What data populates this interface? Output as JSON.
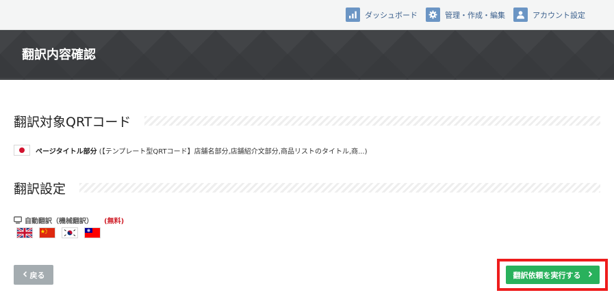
{
  "nav": {
    "items": [
      {
        "label": "ダッシュボード",
        "icon": "bar-chart-icon"
      },
      {
        "label": "管理・作成・編集",
        "icon": "gear-icon"
      },
      {
        "label": "アカウント設定",
        "icon": "user-icon"
      }
    ]
  },
  "banner": {
    "title": "翻訳内容確認"
  },
  "target_section": {
    "heading": "翻訳対象QRTコード",
    "flag_icon": "japan-flag-icon",
    "item_label": "ページタイトル部分",
    "item_detail": " (【テンプレート型QRTコード】店舗名部分,店舗紹介文部分,商品リストのタイトル,商...)"
  },
  "settings_section": {
    "heading": "翻訳設定",
    "auto_icon": "monitor-icon",
    "auto_label": "自動翻訳（機械翻訳）",
    "auto_price": "(無料)",
    "target_flags": [
      "uk-flag-icon",
      "china-flag-icon",
      "korea-flag-icon",
      "taiwan-flag-icon"
    ]
  },
  "buttons": {
    "back_label": "戻る",
    "execute_label": "翻訳依頼を実行する"
  },
  "colors": {
    "nav_icon_bg": "#6b95c4",
    "nav_text": "#3a5f8c",
    "banner_bg": "#3b3d40",
    "back_button": "#a4acb0",
    "execute_button": "#29b15c",
    "highlight_frame": "#ee1c1c",
    "free_text": "#d0202a"
  }
}
